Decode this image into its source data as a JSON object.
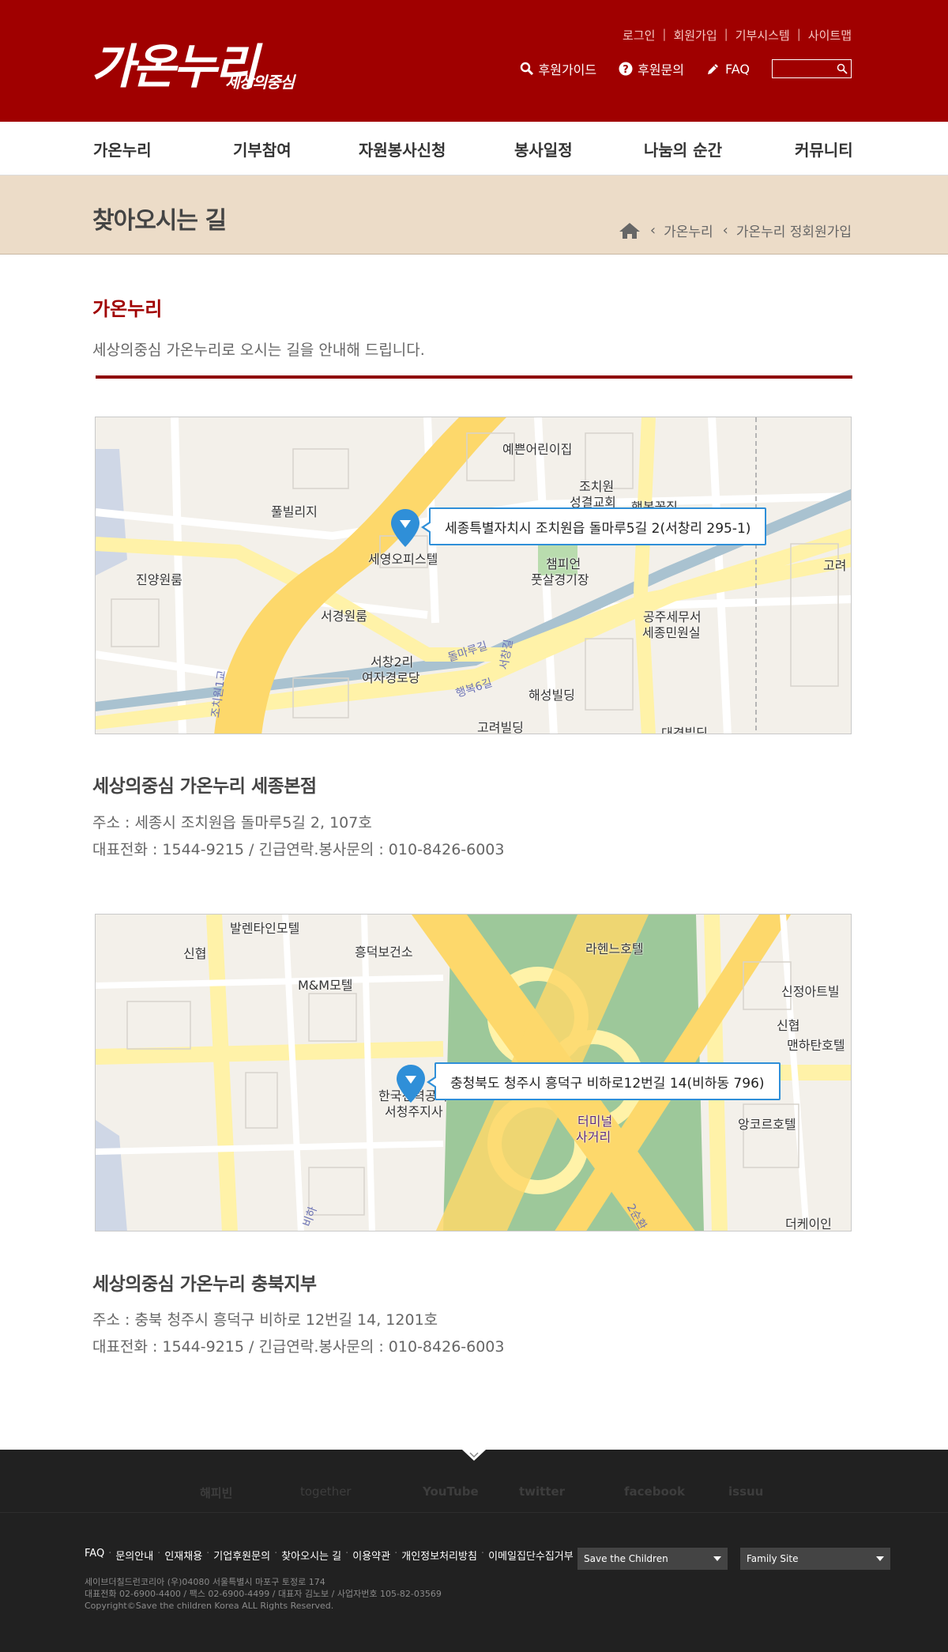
{
  "header": {
    "logo_main": "가온누리",
    "logo_sub": "세상의중심",
    "util_links": [
      "로그인",
      "회원가입",
      "기부시스템",
      "사이트맵"
    ],
    "quick_links": [
      {
        "label": "후원가이드",
        "icon": "search-icon"
      },
      {
        "label": "후원문의",
        "icon": "question-icon"
      },
      {
        "label": "FAQ",
        "icon": "pencil-icon"
      }
    ],
    "search_placeholder": ""
  },
  "nav": {
    "items": [
      "가온누리",
      "기부참여",
      "자원봉사신청",
      "봉사일정",
      "나눔의 순간",
      "커뮤니티"
    ]
  },
  "subvisual": {
    "title": "찾아오시는 길",
    "breadcrumb": [
      "가온누리",
      "가온누리 정회원가입"
    ]
  },
  "content": {
    "section_title": "가온누리",
    "section_desc": "세상의중심 가온누리로 오시는 길을 안내해 드립니다.",
    "branches": [
      {
        "name": "세상의중심 가온누리 세종본점",
        "address": "주소 : 세종시 조치원읍 돌마루5길 2, 107호",
        "phone": "대표전화 : 1544-9215 / 긴급연락.봉사문의 : 010-8426-6003",
        "map_callout": "세종특별자치시 조치원읍 돌마루5길 2(서창리 295-1)",
        "map_labels": [
          "예쁜어린이집",
          "조치원",
          "성결교회",
          "행복꽃집",
          "풀빌리지",
          "세영오피스텔",
          "진양원룸",
          "고려",
          "챔피언",
          "풋살경기장",
          "서경원룸",
          "공주세무서",
          "세종민원실",
          "서창2리",
          "여자경로당",
          "해성빌딩",
          "고려빌딩",
          "대경빌딩"
        ],
        "road_labels": [
          "돌마루길",
          "행복6길",
          "조치원1교",
          "서창길"
        ]
      },
      {
        "name": "세상의중심 가온누리 충북지부",
        "address": "주소 : 충북 청주시 흥덕구 비하로 12번길 14, 1201호",
        "phone": "대표전화 : 1544-9215 / 긴급연락.봉사문의 : 010-8426-6003",
        "map_callout": "충청북도 청주시 흥덕구 비하로12번길 14(비하동 796)",
        "map_labels": [
          "발렌타인모텔",
          "신협",
          "흥덕보건소",
          "M&M모텔",
          "라헨느호텔",
          "신정아트빌",
          "신협",
          "맨하탄호텔",
          "한국전력공사",
          "서청주지사",
          "터미널",
          "사거리",
          "앙코르호텔",
          "더케이인"
        ],
        "road_labels": [
          "비하",
          "2순환"
        ]
      }
    ]
  },
  "footer": {
    "sns": [
      "해피빈",
      "together",
      "YouTube",
      "twitter",
      "facebook",
      "issuu"
    ],
    "links": [
      "FAQ",
      "문의안내",
      "인재채용",
      "기업후원문의",
      "찾아오시는 길",
      "이용약관",
      "개인정보처리방침",
      "이메일집단수집거부"
    ],
    "select1": "Save the Children",
    "select2": "Family Site",
    "info": [
      "세이브더칠드런코리아 (우)04080 서울특별시 마포구 토정로 174",
      "대표전화 02-6900-4400 / 팩스 02-6900-4499 / 대표자 김노보 / 사업자번호 105-82-03569",
      "Copyright©Save the children Korea ALL Rights Reserved."
    ]
  },
  "colors": {
    "brand": "#a00000",
    "subvisual_bg": "#ecdcc8",
    "map_pin": "#2f8fd8",
    "footer_bg": "#212121"
  }
}
